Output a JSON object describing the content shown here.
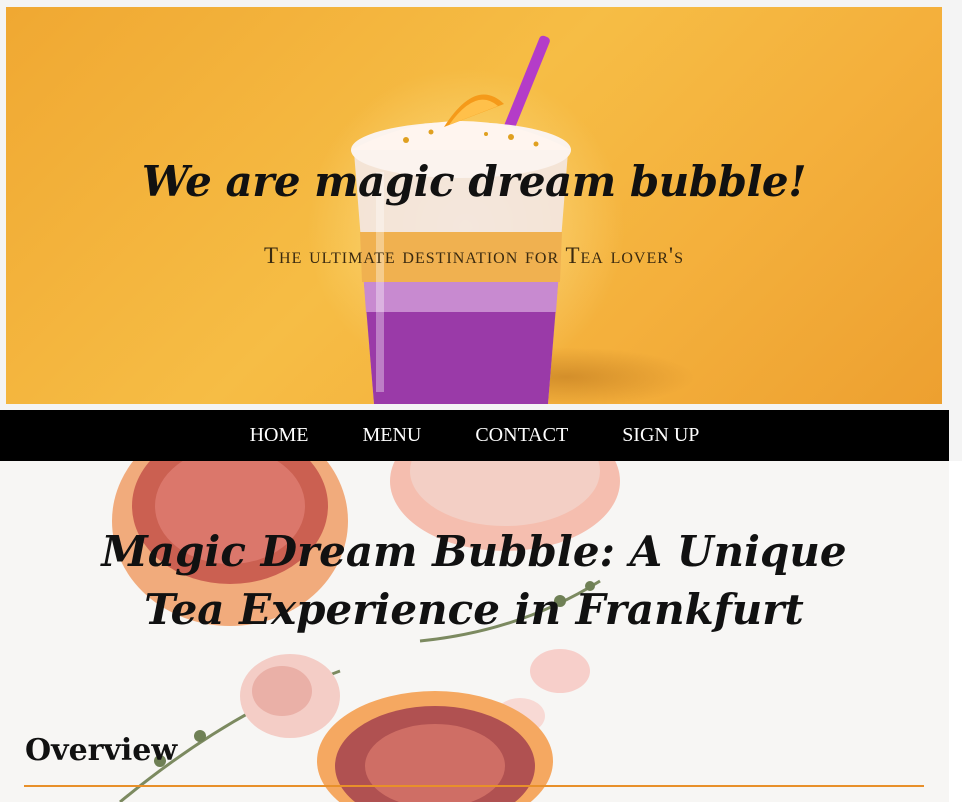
{
  "hero": {
    "title": "We are magic dream bubble!",
    "subtitle": "The ultimate destination for Tea lover's"
  },
  "nav": {
    "items": [
      {
        "label": "HOME"
      },
      {
        "label": "MENU"
      },
      {
        "label": "CONTACT"
      },
      {
        "label": "SIGN UP"
      }
    ]
  },
  "main": {
    "title": "Magic Dream Bubble: A Unique Tea Experience in Frankfurt",
    "section_heading": "Overview"
  },
  "colors": {
    "hero_bg": "#f4b03c",
    "nav_bg": "#000000",
    "accent_rule": "#e8902a"
  }
}
